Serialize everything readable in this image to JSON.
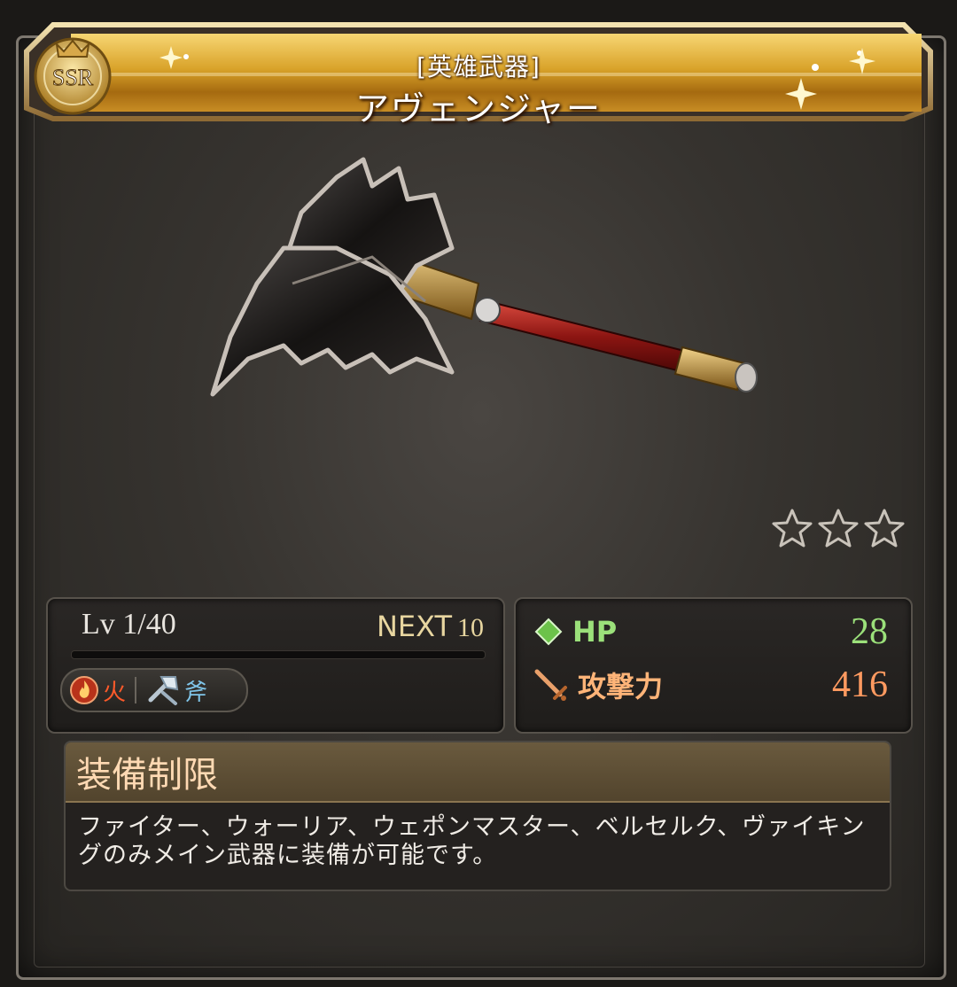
{
  "header": {
    "rarity": "SSR",
    "category": "[英雄武器]",
    "name": "アヴェンジャー"
  },
  "weapon": {
    "icon": "axe-weapon-illustration",
    "stars_total": 3
  },
  "level": {
    "label": "Lv",
    "value": "1/40",
    "next_label": "NEXT",
    "next_value": "10",
    "exp_fraction": 0
  },
  "tags": {
    "element_label": "火",
    "element_icon": "fire-element-icon",
    "type_label": "斧",
    "type_icon": "axe-type-icon"
  },
  "stats": {
    "hp_label": "HP",
    "hp_value": "28",
    "atk_label": "攻撃力",
    "atk_value": "416"
  },
  "restriction": {
    "title": "装備制限",
    "body": "ファイター、ウォーリア、ウェポンマスター、ベルセルク、ヴァイキングのみメイン武器に装備が可能です。"
  },
  "colors": {
    "banner_gold": "#d9a32a",
    "hp_green": "#9be07a",
    "atk_orange": "#ff9a60",
    "fire_red": "#ff5a2a",
    "axe_blue": "#7fc4e8"
  }
}
